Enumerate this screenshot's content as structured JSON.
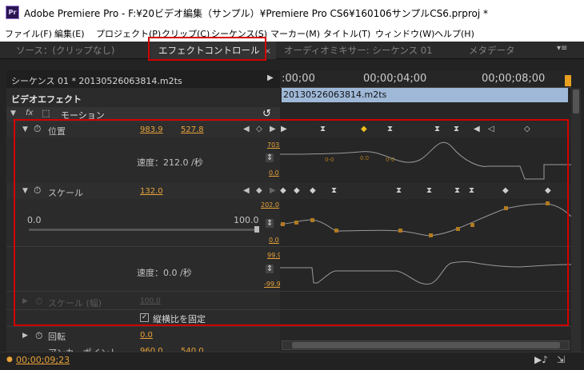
{
  "window": {
    "title": "Adobe Premiere Pro - F:¥20ビデオ編集（サンプル）¥Premiere Pro CS6¥160106サンプルCS6.prproj *",
    "logo": "Pr"
  },
  "menu": [
    "ファイル(F)",
    "編集(E)",
    "プロジェクト(P)",
    "クリップ(C)",
    "シーケンス(S)",
    "マーカー(M)",
    "タイトル(T)",
    "ウィンドウ(W)",
    "ヘルプ(H)"
  ],
  "tabs": {
    "source": "ソース：(クリップなし)",
    "effect": "エフェクトコントロール",
    "close": "×",
    "mixer": "オーディオミキサー: シーケンス 01",
    "meta": "メタデータ",
    "menu_icon": "▾≡"
  },
  "panel": {
    "sequence": "シーケンス 01 * 20130526063814.m2ts",
    "video_effect": "ビデオエフェクト",
    "motion": "モーション",
    "fx": "fx",
    "clip": "20130526063814.m2ts"
  },
  "timecodes": [
    ":00;00",
    "00;00;04;00",
    "00;00;08;00"
  ],
  "position": {
    "label": "位置",
    "x": "983.9",
    "y": "527.8",
    "speed": "速度：212.0 /秒",
    "max": "703.4",
    "min": "0.0",
    "small_vals": [
      "0-0",
      "0.0",
      "0-0"
    ]
  },
  "scale": {
    "label": "スケール",
    "value": "132.0",
    "slider_min": "0.0",
    "slider_max": "100.0",
    "max": "202.0",
    "min": "0.0",
    "speed": "速度：0.0 /秒",
    "smax": "99.9",
    "smin": "-99.9"
  },
  "scale_width": {
    "label": "スケール (幅)",
    "value": "100.0"
  },
  "uniform": {
    "label": "縦横比を固定"
  },
  "rotation": {
    "label": "回転",
    "value": "0.0"
  },
  "anchor": {
    "label": "アンカーポイント",
    "x": "960.0",
    "y": "540.0"
  },
  "current_time": "00;00;09;23",
  "icons": {
    "reset": "reset-icon",
    "stopwatch": "stopwatch-icon",
    "play": "play-audio-icon",
    "export": "export-icon"
  }
}
